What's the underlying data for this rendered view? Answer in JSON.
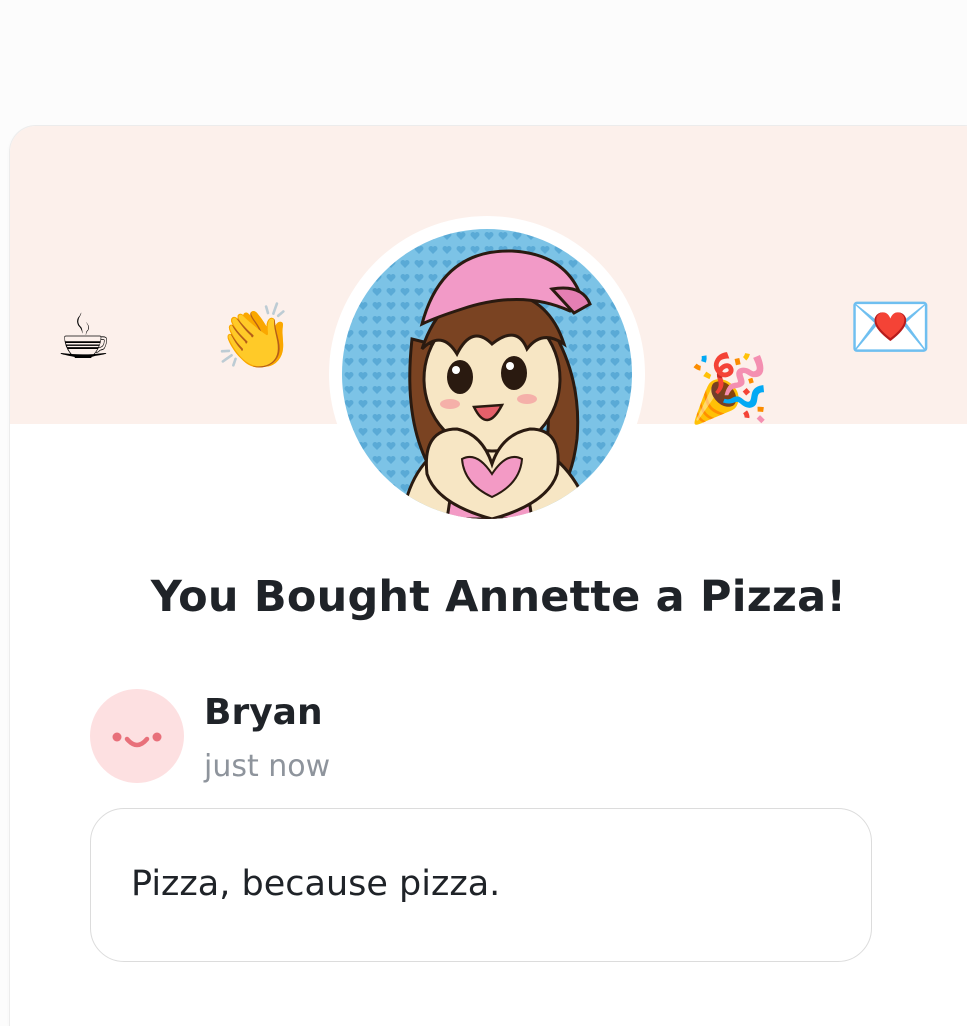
{
  "emojis": {
    "coffee": "☕",
    "clap": "👏",
    "party": "🎉",
    "love_letter": "💌"
  },
  "heading": "You Bought Annette a Pizza!",
  "supporter": {
    "name": "Bryan",
    "time": "just now"
  },
  "message": "Pizza, because pizza.",
  "colors": {
    "banner": "#fcf0eb",
    "avatar_bg": "#fde0e1",
    "face": "#e8707a",
    "title": "#1f2328",
    "muted": "#8e949c"
  },
  "icons": {
    "creator_avatar": "anime-girl-heart-hands-avatar",
    "supporter_avatar": "smiley-face-avatar"
  }
}
